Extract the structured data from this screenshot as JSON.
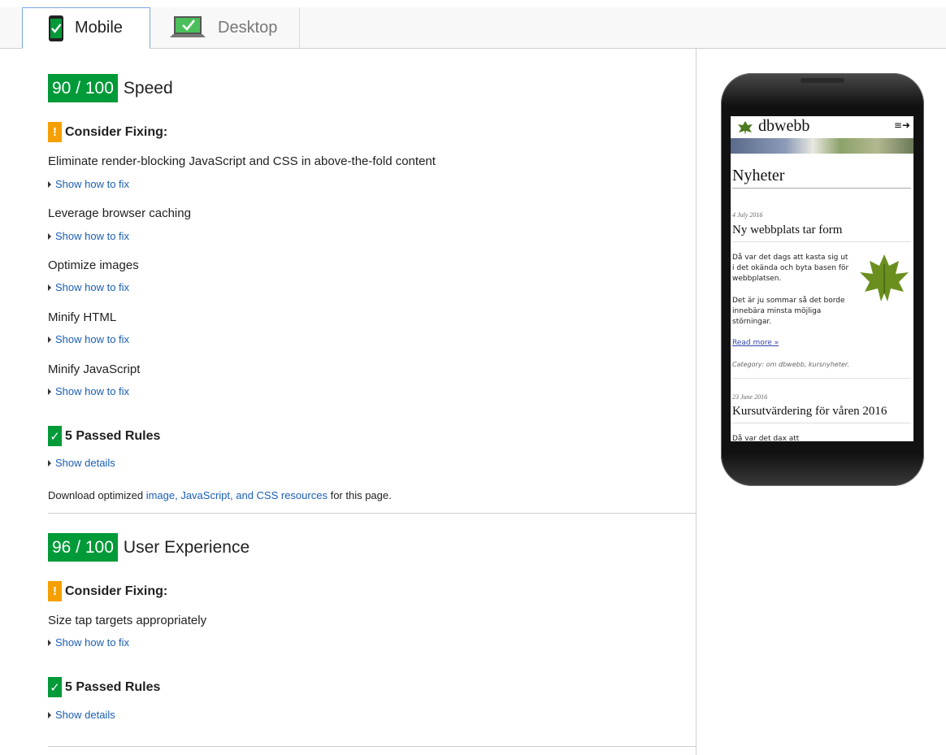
{
  "tabs": {
    "mobile": "Mobile",
    "desktop": "Desktop"
  },
  "speed": {
    "score": "90 / 100",
    "title": "Speed",
    "consider_label": "Consider Fixing:",
    "rules": [
      "Eliminate render-blocking JavaScript and CSS in above-the-fold content",
      "Leverage browser caching",
      "Optimize images",
      "Minify HTML",
      "Minify JavaScript"
    ],
    "show_fix": "Show how to fix",
    "passed_label": "5 Passed Rules",
    "show_details": "Show details",
    "download_prefix": "Download optimized ",
    "download_link": "image, JavaScript, and CSS resources",
    "download_suffix": " for this page."
  },
  "ux": {
    "score": "96 / 100",
    "title": "User Experience",
    "consider_label": "Consider Fixing:",
    "rules": [
      "Size tap targets appropriately"
    ],
    "show_fix": "Show how to fix",
    "passed_label": "5 Passed Rules",
    "show_details": "Show details"
  },
  "preview": {
    "site": "dbwebb",
    "icons": "≡➜",
    "heading": "Nyheter",
    "post1_date": "4 July 2016",
    "post1_title": "Ny webbplats tar form",
    "post1_p1a": "Då var det dags att kasta sig ut",
    "post1_p1b": "i det okända och byta basen för",
    "post1_p1c": "webbplatsen.",
    "post1_p2a": "Det är ju sommar så det borde",
    "post1_p2b": "innebära minsta möjliga",
    "post1_p2c": "störningar.",
    "read_more": "Read more »",
    "category": "Category: om dbwebb, kursnyheter.",
    "post2_date": "23 June 2016",
    "post2_title": "Kursutvärdering för våren 2016",
    "post2_p1": "Då var det dax att"
  },
  "colors": {
    "score_green": "#009a38",
    "warn_orange": "#f5a000",
    "link_blue": "#1a5fb4"
  },
  "icons": {
    "mobile_tab": "phone-check-icon",
    "desktop_tab": "laptop-check-icon"
  }
}
